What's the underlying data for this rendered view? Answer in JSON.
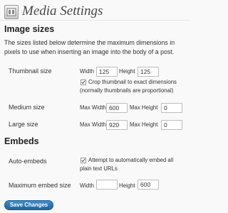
{
  "header": {
    "title": "Media Settings",
    "icon": "media-settings-icon"
  },
  "image_sizes": {
    "heading": "Image sizes",
    "description": "The sizes listed below determine the maximum dimensions in pixels to use when inserting an image into the body of a post.",
    "thumbnail": {
      "label": "Thumbnail size",
      "width_label": "Width",
      "width_value": "125",
      "height_label": "Height",
      "height_value": "125",
      "crop_checked": true,
      "crop_line1": "Crop thumbnail to exact dimensions",
      "crop_line2": "(normally thumbnails are proportional)"
    },
    "medium": {
      "label": "Medium size",
      "width_label": "Max Width",
      "width_value": "600",
      "height_label": "Max Height",
      "height_value": "0"
    },
    "large": {
      "label": "Large size",
      "width_label": "Max Width",
      "width_value": "920",
      "height_label": "Max Height",
      "height_value": "0"
    }
  },
  "embeds": {
    "heading": "Embeds",
    "auto": {
      "label": "Auto-embeds",
      "checked": true,
      "text_line1": "Attempt to automatically embed all",
      "text_line2": "plain text URLs"
    },
    "max_size": {
      "label": "Maximum embed size",
      "width_label": "Width",
      "width_value": "",
      "height_label": "Height",
      "height_value": "600"
    }
  },
  "save_button": "Save Changes",
  "colors": {
    "accent": "#21629b",
    "background": "#f9f9f9"
  }
}
